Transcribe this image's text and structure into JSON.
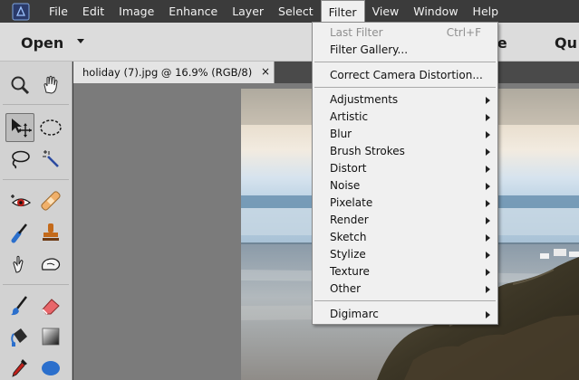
{
  "menubar": {
    "items": [
      "File",
      "Edit",
      "Image",
      "Enhance",
      "Layer",
      "Select",
      "Filter",
      "View",
      "Window",
      "Help"
    ],
    "active": "Filter"
  },
  "optionbar": {
    "open_label": "Open",
    "quick_label": "ive",
    "guided_label": "Qu"
  },
  "document": {
    "tab_title": "holiday (7).jpg @ 16.9% (RGB/8)",
    "close_glyph": "×"
  },
  "filter_menu": {
    "last_filter": "Last Filter",
    "last_filter_shortcut": "Ctrl+F",
    "filter_gallery": "Filter Gallery...",
    "correct_camera": "Correct Camera Distortion...",
    "submenus": [
      "Adjustments",
      "Artistic",
      "Blur",
      "Brush Strokes",
      "Distort",
      "Noise",
      "Pixelate",
      "Render",
      "Sketch",
      "Stylize",
      "Texture",
      "Other"
    ],
    "digimarc": "Digimarc"
  },
  "tools": [
    "zoom-icon",
    "hand-icon",
    "move-icon",
    "marquee-icon",
    "lasso-icon",
    "magic-wand-icon",
    "red-eye-icon",
    "spot-healing-icon",
    "smart-brush-icon",
    "clone-stamp-icon",
    "smudge-icon",
    "eraser-icon",
    "brush-icon",
    "paint-bucket-icon",
    "gradient-icon",
    "eyedropper-icon",
    "shape-icon"
  ],
  "colors": {
    "menubar_bg": "#3b3b3b",
    "optionbar_bg": "#dcdcdc",
    "toolpanel_bg": "#d2d2d2",
    "canvas_bg": "#7b7b7b",
    "menu_bg": "#f0f0f0"
  }
}
